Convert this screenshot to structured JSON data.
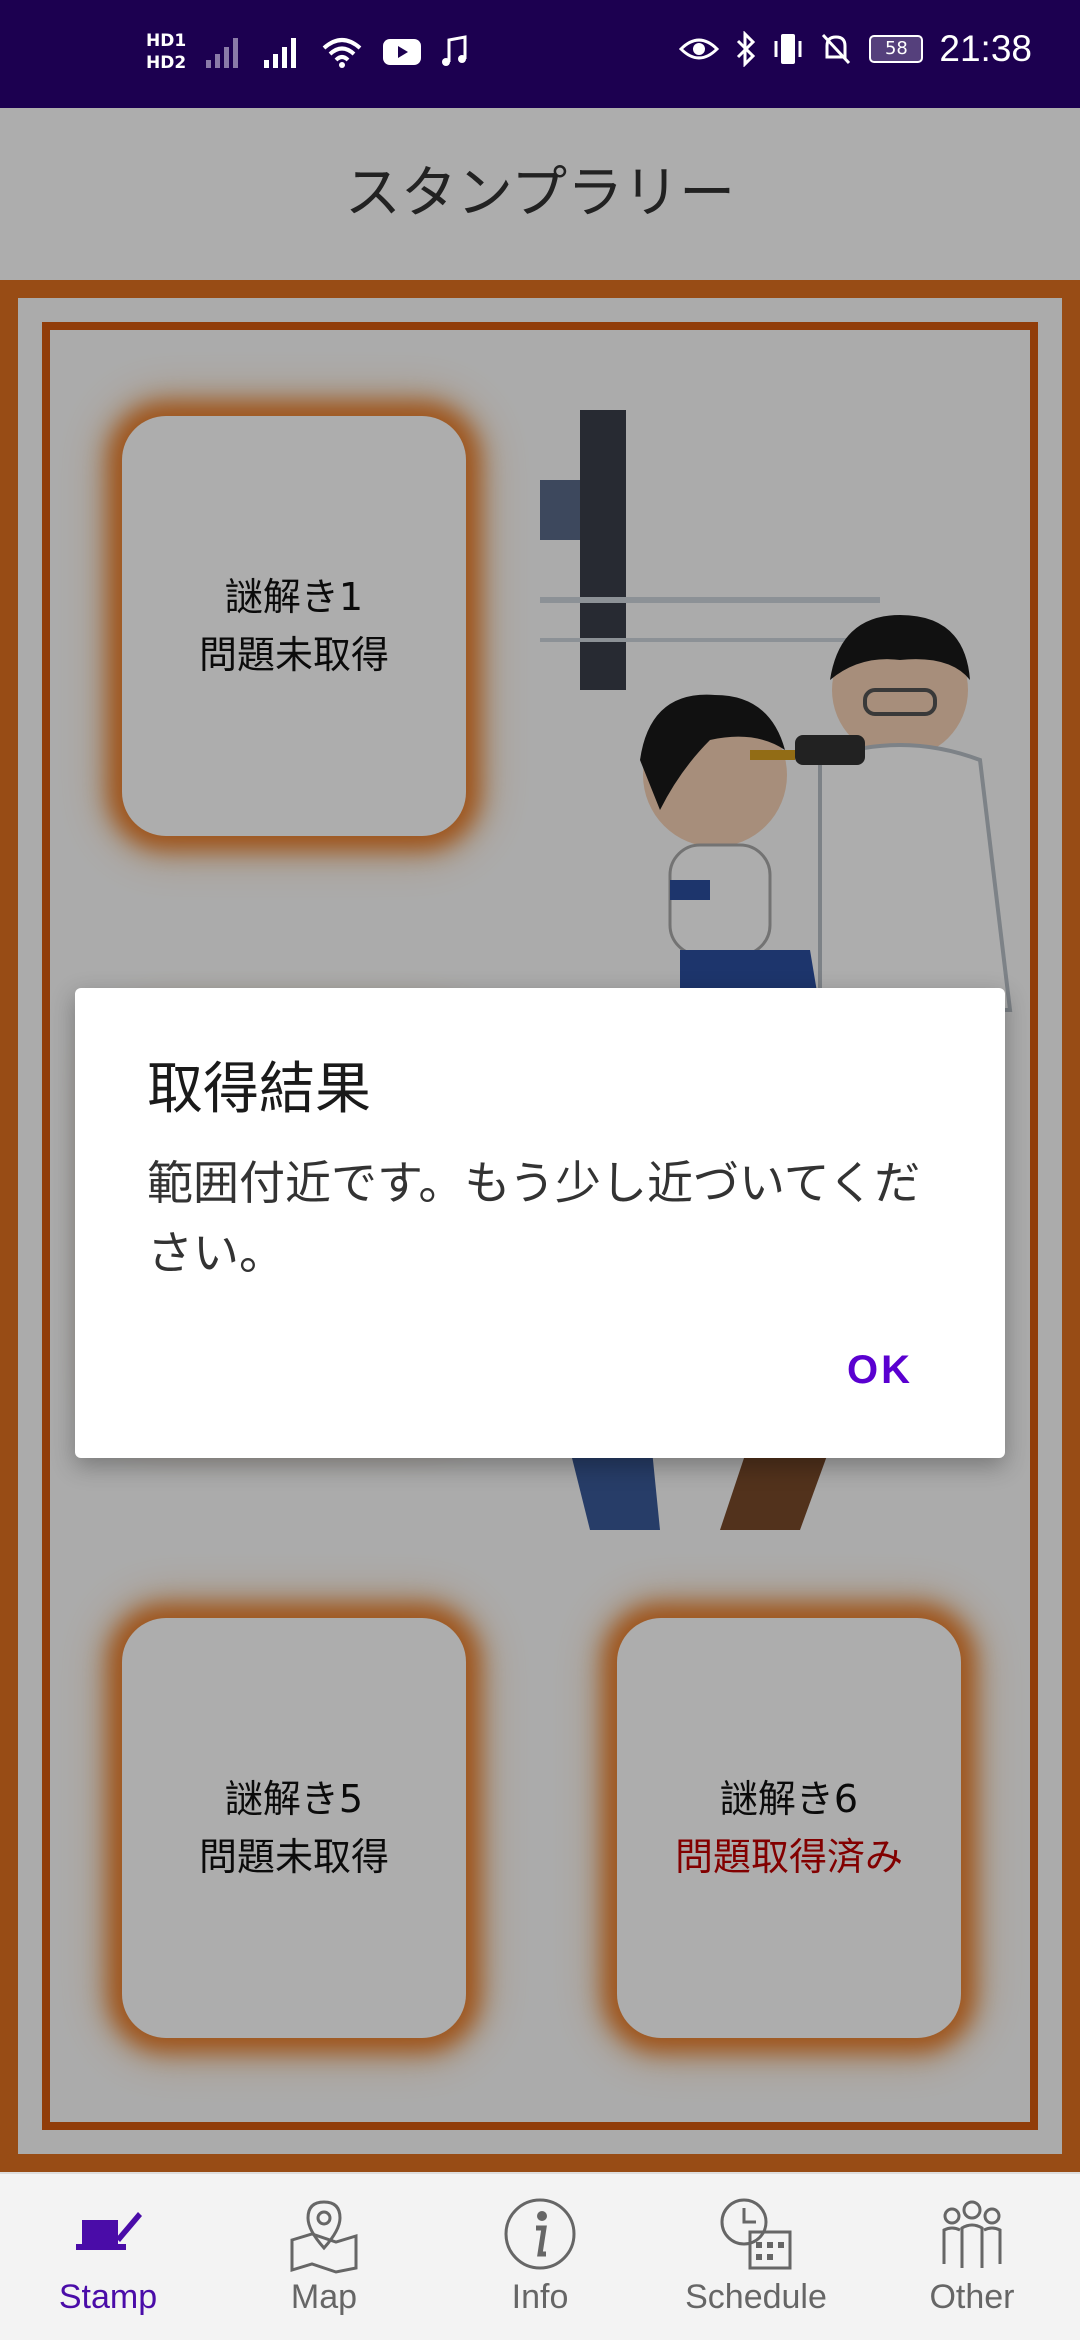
{
  "status_bar": {
    "hd1": "HD1",
    "hd2": "HD2",
    "time": "21:38",
    "battery": "58",
    "icons": [
      "signal-icon",
      "signal-icon",
      "wifi-icon",
      "youtube-icon",
      "music-icon",
      "eye-icon",
      "bluetooth-icon",
      "vibrate-icon",
      "mute-icon",
      "battery-icon"
    ]
  },
  "header": {
    "title": "スタンプラリー"
  },
  "stamps": [
    {
      "name": "謎解き1",
      "status": "問題未取得",
      "status_color": "#111111"
    },
    {
      "name": "謎解き5",
      "status": "問題未取得",
      "status_color": "#111111"
    },
    {
      "name": "謎解き6",
      "status": "問題取得済み",
      "status_color": "#c00000"
    }
  ],
  "dialog": {
    "title": "取得結果",
    "message": "範囲付近です。もう少し近づいてください。",
    "ok_label": "OK"
  },
  "nav": {
    "items": [
      {
        "label": "Stamp",
        "icon": "stamp-icon",
        "active": true
      },
      {
        "label": "Map",
        "icon": "map-icon",
        "active": false
      },
      {
        "label": "Info",
        "icon": "info-icon",
        "active": false
      },
      {
        "label": "Schedule",
        "icon": "schedule-icon",
        "active": false
      },
      {
        "label": "Other",
        "icon": "people-icon",
        "active": false
      }
    ]
  },
  "colors": {
    "status_bar": "#1c0050",
    "accent": "#5a00d0",
    "frame": "#e07020",
    "acquired": "#c00000"
  }
}
